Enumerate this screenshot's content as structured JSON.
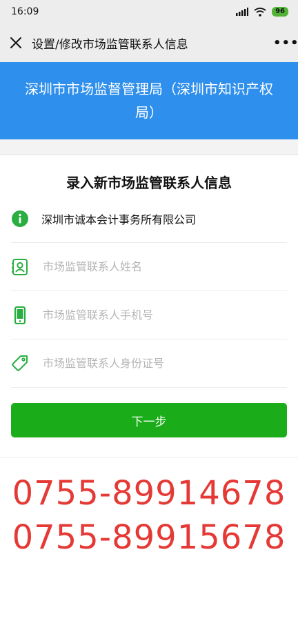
{
  "status_bar": {
    "time": "16:09",
    "battery": "96"
  },
  "nav": {
    "title": "设置/修改市场监管联系人信息"
  },
  "banner": {
    "text": "深圳市市场监督管理局（深圳市知识产权局）"
  },
  "form": {
    "heading": "录入新市场监管联系人信息",
    "company": "深圳市诚本会计事务所有限公司",
    "name_placeholder": "市场监管联系人姓名",
    "phone_placeholder": "市场监管联系人手机号",
    "id_placeholder": "市场监管联系人身份证号",
    "next_label": "下一步"
  },
  "phones": [
    "0755-89914678",
    "0755-89915678"
  ],
  "colors": {
    "banner": "#2f8fec",
    "button": "#1aad19",
    "icon": "#2aae41",
    "phone_text": "#e53935"
  }
}
